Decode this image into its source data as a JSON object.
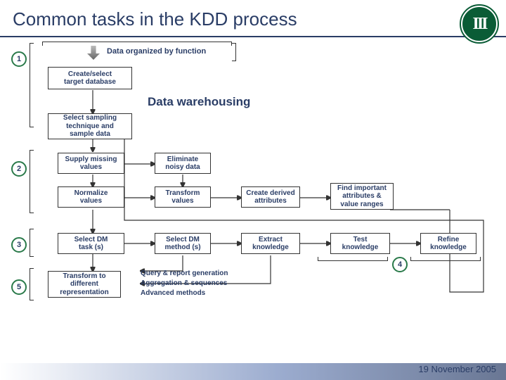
{
  "title": "Common tasks in the KDD process",
  "footer_date": "19 November 2005",
  "numbers": {
    "n1": "1",
    "n2": "2",
    "n3": "3",
    "n4": "4",
    "n5": "5"
  },
  "labels": {
    "data_org": "Data organized by function",
    "data_wh": "Data warehousing",
    "query": "Query & report generation",
    "agg": "Aggregation & sequences",
    "adv": "Advanced methods"
  },
  "boxes": {
    "create": "Create/select\ntarget database",
    "sampling": "Select sampling\ntechnique and\nsample data",
    "supply": "Supply missing\nvalues",
    "elim": "Eliminate\nnoisy data",
    "norm": "Normalize\nvalues",
    "transv": "Transform\nvalues",
    "derived": "Create derived\nattributes",
    "findimp": "Find important\nattributes &\nvalue ranges",
    "dmtask": "Select DM\ntask (s)",
    "dmmethod": "Select DM\nmethod (s)",
    "extract": "Extract\nknowledge",
    "test": "Test\nknowledge",
    "refine": "Refine\nknowledge",
    "transrep": "Transform to\ndifferent\nrepresentation"
  }
}
